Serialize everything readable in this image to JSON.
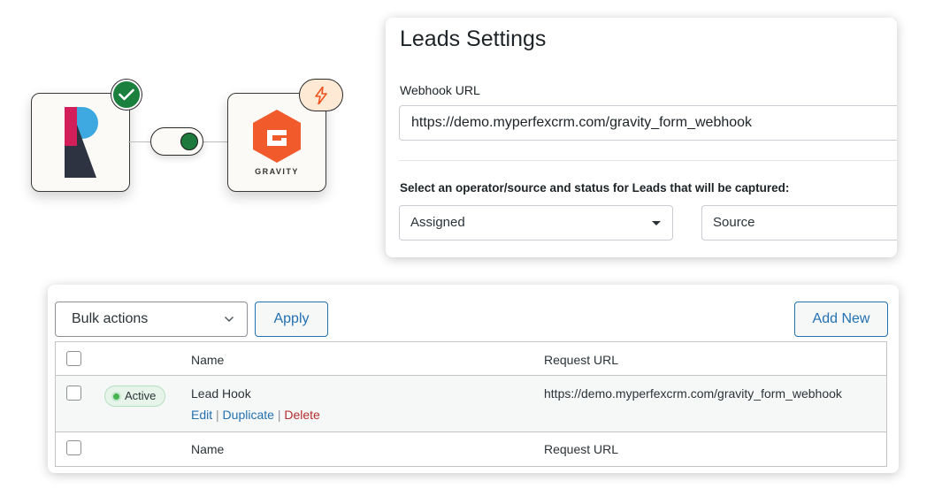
{
  "illustration": {
    "left_app": {
      "name": "perfex-logo"
    },
    "right_app": {
      "name": "gravity-forms-logo",
      "wordmark": "GRAVITY"
    },
    "status_badge_icon": "check-icon",
    "trigger_badge_icon": "lightning-bolt-icon",
    "colors": {
      "toggle_on": "#1e7a3c",
      "check_badge": "#1b7f3e",
      "bolt_badge_bg": "#fde9d4",
      "bolt": "#f0541e",
      "gravity_orange": "#f15a2b"
    }
  },
  "settings": {
    "title": "Leads Settings",
    "webhook_label": "Webhook URL",
    "webhook_value": "https://demo.myperfexcrm.com/gravity_form_webhook",
    "capture_label": "Select an operator/source and status for Leads that will be captured:",
    "operator_select": "Assigned",
    "source_select": "Source"
  },
  "list": {
    "bulk_actions": "Bulk actions",
    "apply_button": "Apply",
    "add_new_button": "Add New",
    "columns": {
      "name": "Name",
      "request_url": "Request URL"
    },
    "rows": [
      {
        "status": "Active",
        "name": "Lead Hook",
        "request_url": "https://demo.myperfexcrm.com/gravity_form_webhook",
        "actions": {
          "edit": "Edit",
          "duplicate": "Duplicate",
          "delete": "Delete",
          "separator": "|"
        }
      }
    ],
    "colors": {
      "link": "#2271b1",
      "delete": "#b32d2e",
      "active_dot": "#46b450"
    }
  }
}
